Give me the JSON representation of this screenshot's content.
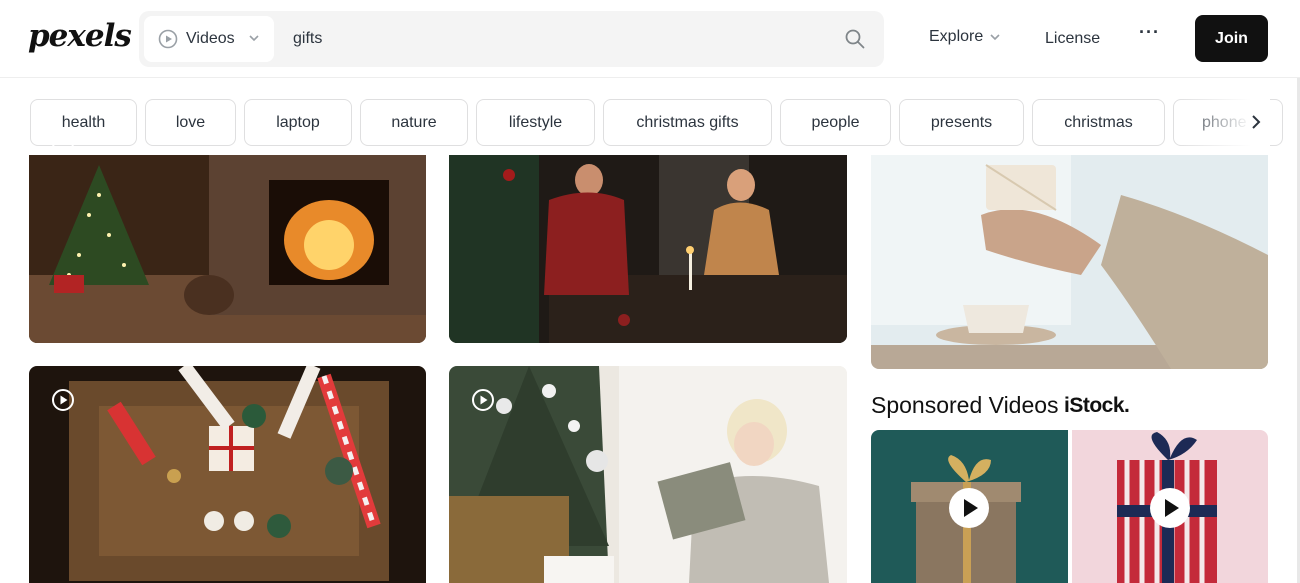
{
  "logo": "pexels",
  "search": {
    "type_label": "Videos",
    "query": "gifts",
    "type_icon": "play-circle-icon",
    "search_icon": "search-icon"
  },
  "nav": {
    "explore": "Explore",
    "license": "License",
    "more": "···",
    "join": "Join"
  },
  "chips": [
    "health",
    "love",
    "laptop",
    "nature",
    "lifestyle",
    "christmas gifts",
    "people",
    "presents",
    "christmas",
    "phone"
  ],
  "sponsored": {
    "title": "Sponsored Videos",
    "brand": "iStock."
  },
  "colors": {
    "join_bg": "#111111",
    "search_bg": "#f4f4f4",
    "chip_border": "#dfdfe0"
  }
}
